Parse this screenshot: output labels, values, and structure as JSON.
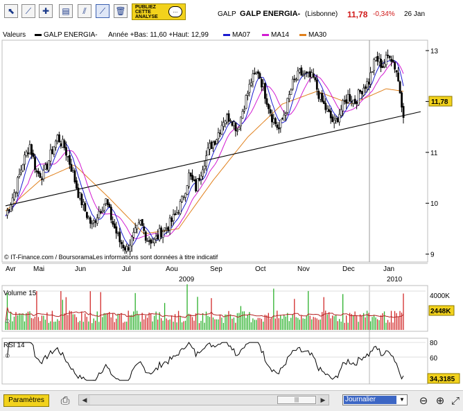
{
  "toolbar": {
    "tools": [
      "cursor-icon",
      "line-tool-icon",
      "plus-line-icon",
      "indicator-icon",
      "parallel-tool-icon",
      "trend-tool-icon",
      "trash-icon"
    ],
    "publish_text": "PUBLIEZ\nCETTE\nANALYSE",
    "publish_bubble": "..."
  },
  "header": {
    "ticker": "GALP",
    "name": "GALP ENERGIA-",
    "market": "(Lisbonne)",
    "price": "11,78",
    "change": "-0,34%",
    "date": "26 Jan"
  },
  "legend": {
    "valeurs": "Valeurs",
    "series_label": "GALP ENERGIA-",
    "stats": "Année +Bas: 11,60 +Haut: 12,99",
    "ma07": "MA07",
    "ma14": "MA14",
    "ma30": "MA30"
  },
  "colors": {
    "ma07": "#1a1ad0",
    "ma14": "#d21ad2",
    "ma30": "#e0801c",
    "candle": "#000000",
    "up_bar": "#2ab02a",
    "down_bar": "#d22828",
    "price_tag": "#f2d21c"
  },
  "copyright": "© IT-Finance.com / BoursoramaLes informations sont données à titre indicatif",
  "price_label": "11,78",
  "volume_panel": {
    "title": "Volume 15",
    "max_label": "4000K",
    "current_label": "2448K"
  },
  "rsi_panel": {
    "title": "RSI 14",
    "current_label": "34,3185"
  },
  "bottom": {
    "params_label": "Paramètres",
    "period": "Journalier"
  },
  "chart_data": {
    "type": "candlestick",
    "title": "GALP ENERGIA-",
    "ylim": [
      8.9,
      13.15
    ],
    "yticks": [
      9,
      10,
      11,
      12,
      13
    ],
    "months": [
      "Avr",
      "Mai",
      "Jun",
      "Jul",
      "Aou",
      "Sep",
      "Oct",
      "Nov",
      "Dec",
      "Jan"
    ],
    "years": [
      "2009",
      "2010"
    ],
    "close_path": [
      [
        0,
        9.75
      ],
      [
        6,
        10.3
      ],
      [
        10,
        10.8
      ],
      [
        14,
        11.15
      ],
      [
        18,
        10.6
      ],
      [
        22,
        10.55
      ],
      [
        26,
        10.95
      ],
      [
        30,
        11.3
      ],
      [
        34,
        11.1
      ],
      [
        38,
        10.7
      ],
      [
        42,
        10.2
      ],
      [
        46,
        9.85
      ],
      [
        50,
        9.55
      ],
      [
        54,
        9.85
      ],
      [
        58,
        10.05
      ],
      [
        62,
        9.6
      ],
      [
        66,
        9.25
      ],
      [
        70,
        9.1
      ],
      [
        74,
        9.35
      ],
      [
        78,
        9.6
      ],
      [
        82,
        9.3
      ],
      [
        86,
        9.25
      ],
      [
        90,
        9.45
      ],
      [
        94,
        9.55
      ],
      [
        98,
        9.75
      ],
      [
        102,
        10.05
      ],
      [
        106,
        10.55
      ],
      [
        110,
        10.3
      ],
      [
        114,
        10.75
      ],
      [
        118,
        11.1
      ],
      [
        122,
        11.3
      ],
      [
        126,
        11.65
      ],
      [
        130,
        11.7
      ],
      [
        134,
        11.45
      ],
      [
        138,
        11.95
      ],
      [
        142,
        12.4
      ],
      [
        146,
        12.6
      ],
      [
        150,
        12.15
      ],
      [
        154,
        11.7
      ],
      [
        158,
        11.45
      ],
      [
        162,
        11.85
      ],
      [
        166,
        12.35
      ],
      [
        170,
        12.55
      ],
      [
        174,
        12.5
      ],
      [
        178,
        12.45
      ],
      [
        182,
        12.05
      ],
      [
        186,
        11.8
      ],
      [
        190,
        11.55
      ],
      [
        194,
        11.85
      ],
      [
        198,
        12.1
      ],
      [
        202,
        12.0
      ],
      [
        206,
        12.25
      ],
      [
        210,
        12.4
      ],
      [
        214,
        12.85
      ],
      [
        218,
        12.7
      ],
      [
        222,
        12.95
      ],
      [
        226,
        12.6
      ],
      [
        228,
        12.2
      ],
      [
        230,
        11.78
      ]
    ],
    "ma30_path": [
      [
        0,
        9.85
      ],
      [
        20,
        10.45
      ],
      [
        40,
        10.75
      ],
      [
        60,
        10.1
      ],
      [
        80,
        9.4
      ],
      [
        100,
        9.5
      ],
      [
        120,
        10.45
      ],
      [
        140,
        11.3
      ],
      [
        160,
        11.95
      ],
      [
        180,
        12.2
      ],
      [
        200,
        11.95
      ],
      [
        220,
        12.25
      ],
      [
        230,
        12.2
      ]
    ],
    "trendline": {
      "from": [
        0,
        9.95
      ],
      "to": [
        240,
        11.8
      ]
    },
    "volume_max": 4000,
    "volume_current": 2448,
    "rsi_ticks": [
      60,
      80
    ],
    "rsi_current": 34.3185
  }
}
